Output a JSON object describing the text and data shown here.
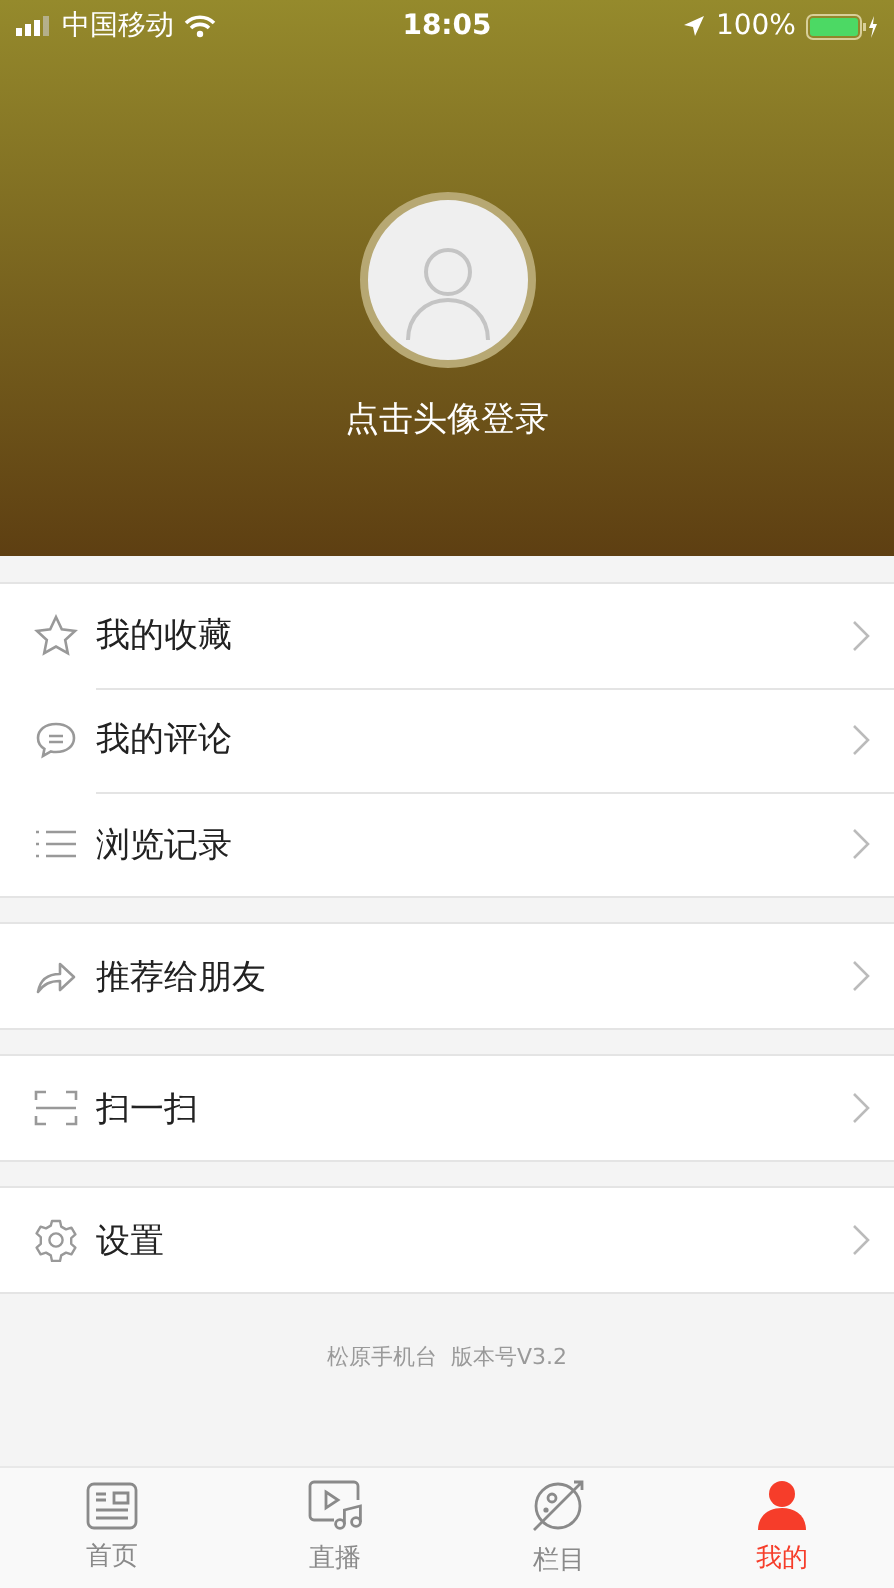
{
  "status_bar": {
    "carrier": "中国移动",
    "time": "18:05",
    "battery": "100%"
  },
  "profile": {
    "login_prompt": "点击头像登录"
  },
  "menu_groups": [
    {
      "items": [
        {
          "kind": "star",
          "label": "我的收藏"
        },
        {
          "kind": "comment",
          "label": "我的评论"
        },
        {
          "kind": "list",
          "label": "浏览记录"
        }
      ]
    },
    {
      "items": [
        {
          "kind": "share",
          "label": "推荐给朋友"
        }
      ]
    },
    {
      "items": [
        {
          "kind": "scan",
          "label": "扫一扫"
        }
      ]
    },
    {
      "items": [
        {
          "kind": "gear",
          "label": "设置"
        }
      ]
    }
  ],
  "version": "松原手机台  版本号V3.2",
  "tabs": [
    {
      "kind": "news",
      "label": "首页",
      "selected": false
    },
    {
      "kind": "live",
      "label": "直播",
      "selected": false
    },
    {
      "kind": "planet",
      "label": "栏目",
      "selected": false
    },
    {
      "kind": "person",
      "label": "我的",
      "selected": true
    }
  ]
}
